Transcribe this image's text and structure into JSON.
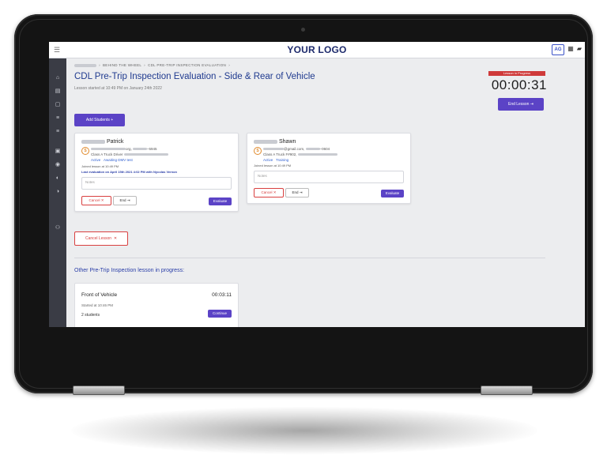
{
  "app": {
    "logo": "YOUR LOGO",
    "avatar_initials": "AG"
  },
  "breadcrumb": {
    "items": [
      "BEHIND THE WHEEL",
      "CDL PRE-TRIP INSPECTION EVALUATION"
    ]
  },
  "page": {
    "title": "CDL Pre-Trip Inspection Evaluation - Side & Rear of Vehicle",
    "subtitle": "Lesson started at 10:49 PM on January 24th 2022"
  },
  "status": {
    "badge": "Lesson in Progress",
    "timer": "00:00:31",
    "end_lesson": "End Lesson"
  },
  "actions": {
    "add_students": "Add Students",
    "cancel_lesson": "Cancel Lesson"
  },
  "students": [
    {
      "first_name": "Patrick",
      "email_end": "org,",
      "phone_end": "5945",
      "vehicle": "Class A Truck Driver",
      "status": "Active",
      "stage": "Awaiting DMV test",
      "joined": "Joined lesson at 10:49 PM",
      "last_eval": "Last evaluation on April 15th 2021 4:02 PM with Nycolas Vernon",
      "notes_placeholder": "Notes",
      "cancel": "Cancel",
      "end": "End",
      "evaluate": "Evaluate"
    },
    {
      "first_name": "Shawn",
      "email_end": "@gmail.com,",
      "phone_end": "0604",
      "vehicle": "Class A Truck F#902,",
      "status": "Active",
      "stage": "Training",
      "joined": "Joined lesson at 10:49 PM",
      "notes_placeholder": "Notes",
      "cancel": "Cancel",
      "end": "End",
      "evaluate": "Evaluate"
    }
  ],
  "other": {
    "heading": "Other Pre-Trip Inspection lesson in progress:",
    "lesson": {
      "title": "Front of Vehicle",
      "time": "00:03:11",
      "started": "Started at 10:46 PM",
      "count": "2 students",
      "continue": "Continue"
    }
  },
  "colors": {
    "accent": "#5b43c6",
    "title": "#1f3a8f",
    "danger": "#d94040",
    "warning": "#e08a2c"
  }
}
